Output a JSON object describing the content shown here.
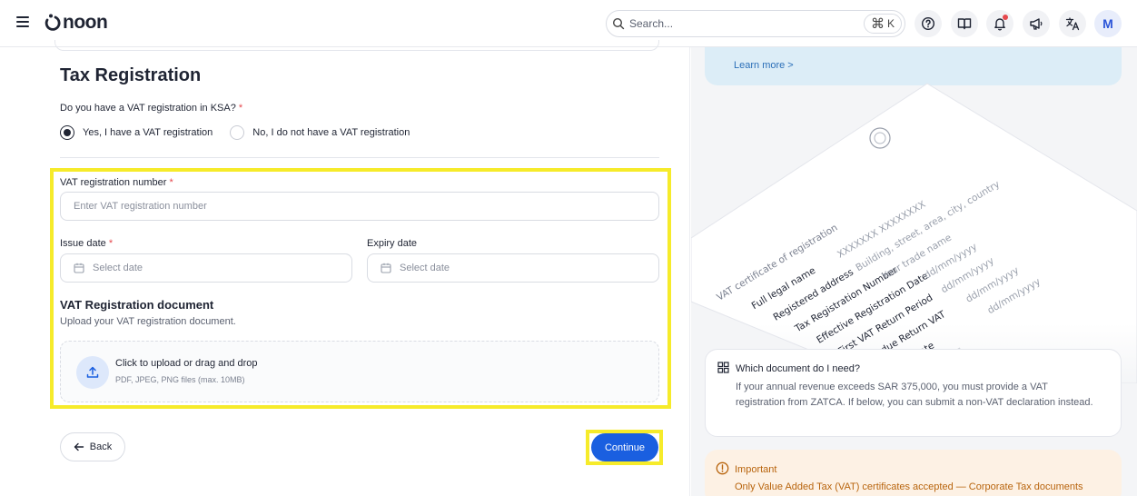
{
  "header": {
    "logo_text": "noon",
    "search_placeholder": "Search...",
    "shortcut_symbol": "⌘",
    "shortcut_key": "K",
    "avatar_initial": "M",
    "icons": [
      "help-icon",
      "book-icon",
      "bell-icon",
      "megaphone-icon",
      "translate-icon"
    ]
  },
  "form": {
    "title": "Tax Registration",
    "vat_question": "Do you have a VAT registration in KSA?",
    "required_mark": "*",
    "options": {
      "yes": "Yes, I have a VAT registration",
      "no": "No, I do not have a VAT registration"
    },
    "selected_option": "yes",
    "vat_number_label": "VAT registration number",
    "vat_number_placeholder": "Enter VAT registration number",
    "issue_date_label": "Issue date",
    "expiry_date_label": "Expiry date",
    "date_placeholder": "Select date",
    "doc_title": "VAT Registration document",
    "doc_subtitle": "Upload your VAT registration document.",
    "upload_main": "Click to upload or drag and drop",
    "upload_sub": "PDF, JPEG, PNG files (max. 10MB)",
    "back_label": "Back",
    "continue_label": "Continue"
  },
  "side": {
    "learn_more": "Learn more >",
    "certificate": {
      "heading": "VAT certificate of registration",
      "rows": [
        {
          "label": "Full legal name",
          "value": "XXXXXXX XXXXXXXX"
        },
        {
          "label": "Registered address",
          "value": "Building, street, area, city, country"
        },
        {
          "label": "Tax Registration Number",
          "value": "Your trade name"
        },
        {
          "label": "Effective Registration Date",
          "value": "dd/mm/yyyy"
        },
        {
          "label": "First VAT Return Period",
          "value": "dd/mm/yyyy"
        },
        {
          "label": "date due Return VAT",
          "value": "dd/mm/yyyy"
        },
        {
          "label": "Issuing Date",
          "value": "dd/mm/yyyy"
        }
      ]
    },
    "which_doc_title": "Which document do I need?",
    "which_doc_body": "If your annual revenue exceeds SAR 375,000, you must provide a VAT registration from ZATCA. If below, you can submit a non-VAT declaration instead.",
    "important_title": "Important",
    "important_body": "Only Value Added Tax (VAT) certificates accepted — Corporate Tax documents"
  },
  "colors": {
    "primary": "#1a5fe0",
    "highlight": "#f6eb2a",
    "required": "#e5484d",
    "info_bg": "#dcedf7",
    "warning_bg": "#fdf1e4",
    "warning_text": "#b8640d"
  }
}
